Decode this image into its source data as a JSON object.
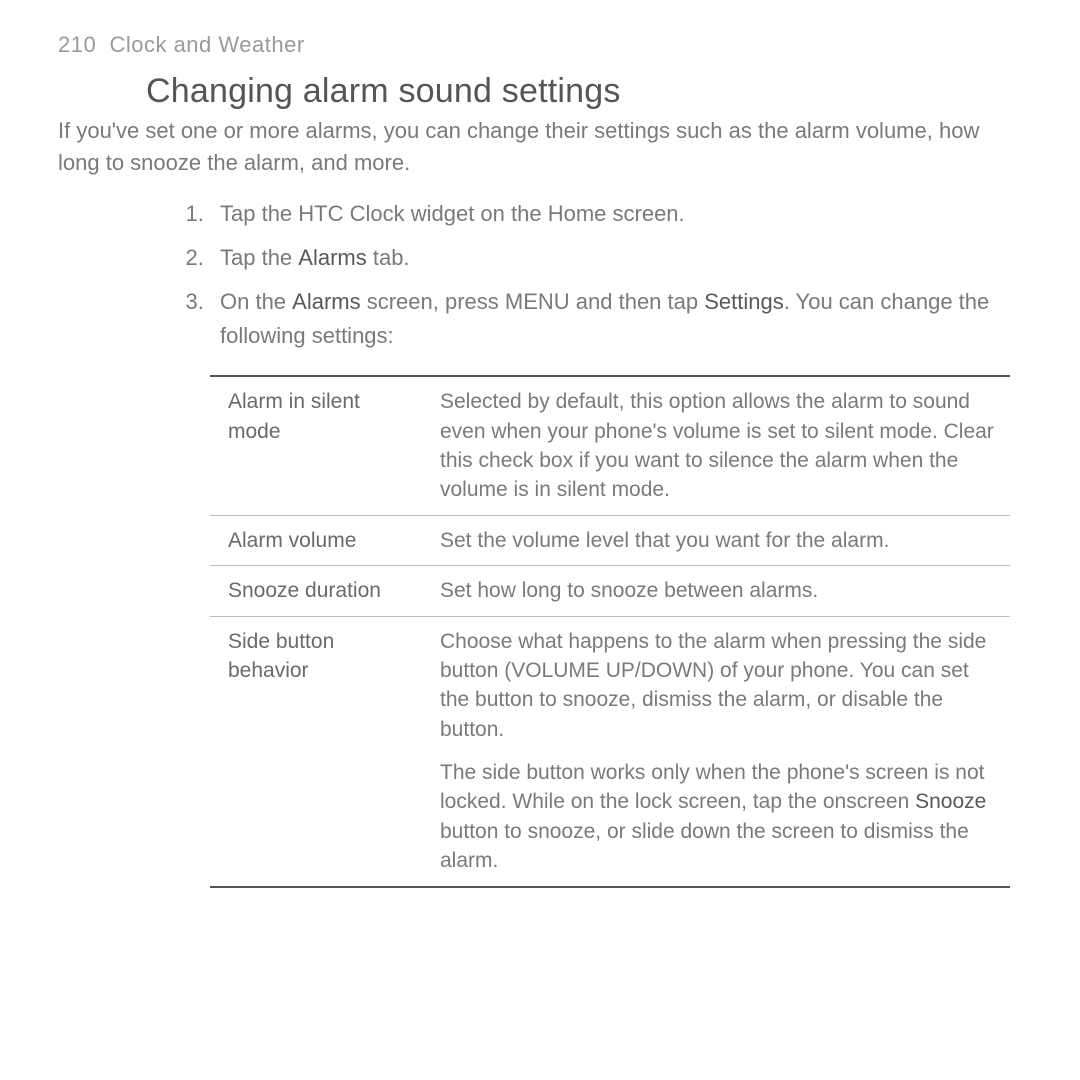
{
  "header": {
    "page_number": "210",
    "chapter": "Clock and Weather"
  },
  "section": {
    "title": "Changing alarm sound settings",
    "intro": "If you've set one or more alarms, you can change their settings such as the alarm volume, how long to snooze the alarm, and more."
  },
  "steps": {
    "s1": "Tap the HTC Clock widget on the Home screen.",
    "s2_a": "Tap the ",
    "s2_b_bold": "Alarms",
    "s2_c": " tab.",
    "s3_a": "On the ",
    "s3_b_bold": "Alarms",
    "s3_c": " screen, press MENU and then tap ",
    "s3_d_bold": "Settings",
    "s3_e": ". You can change the following settings:"
  },
  "table": {
    "r1_label": "Alarm in silent mode",
    "r1_desc": "Selected by default, this option allows the alarm to sound even when your phone's volume is set to silent mode. Clear this check box if you want to silence the alarm when the volume is in silent mode.",
    "r2_label": "Alarm volume",
    "r2_desc": "Set the volume level that you want for the alarm.",
    "r3_label": "Snooze duration",
    "r3_desc": "Set how long to snooze between alarms.",
    "r4_label": "Side button behavior",
    "r4_desc": "Choose what happens to the alarm when pressing the side button (VOLUME UP/DOWN) of your phone. You can set the button to snooze, dismiss the alarm, or disable the button.",
    "r4b_a": "The side button works only when the phone's screen is not locked. While on the lock screen, tap the onscreen ",
    "r4b_b_bold": "Snooze",
    "r4b_c": " button to snooze, or slide down the screen to dismiss the alarm."
  }
}
